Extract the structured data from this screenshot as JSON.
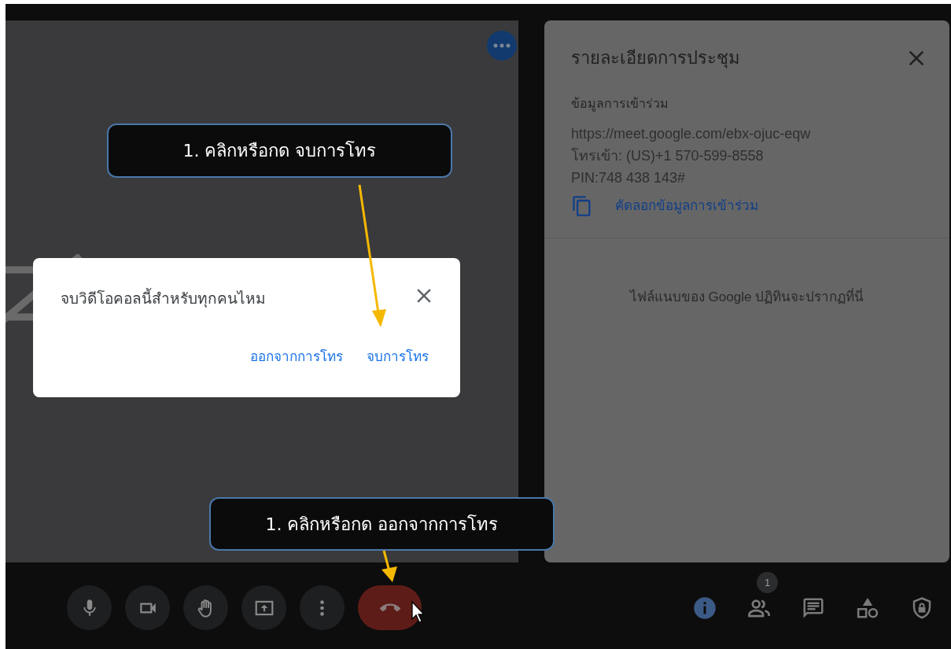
{
  "meeting_details": {
    "title": "รายละเอียดการประชุม",
    "section_heading": "ข้อมูลการเข้าร่วม",
    "join_info": [
      "https://meet.google.com/ebx-ojuc-eqw",
      "โทรเข้า: (US)+1 570-599-8558",
      "PIN:748 438 143#"
    ],
    "copy_link": "คัดลอกข้อมูลการเข้าร่วม",
    "attachments_note": "ไฟล์แนบของ Google ปฏิทินจะปรากฏที่นี่"
  },
  "dialog": {
    "question": "จบวิดีโอคอลนี้สำหรับทุกคนไหม",
    "buttons": [
      "ออกจากการโทร",
      "จบการโทร"
    ]
  },
  "callouts": [
    {
      "text": "1. คลิกหรือกด จบการโทร"
    },
    {
      "text": "1. คลิกหรือกด ออกจากการโทร"
    }
  ],
  "controls": [
    {
      "kind": "mic"
    },
    {
      "kind": "camera"
    },
    {
      "kind": "hand"
    },
    {
      "kind": "present"
    },
    {
      "kind": "more"
    },
    {
      "kind": "end_call"
    }
  ],
  "side_controls": [
    {
      "kind": "info",
      "selected": true
    },
    {
      "kind": "people",
      "selected": false,
      "badge": "1"
    },
    {
      "kind": "chat",
      "selected": false
    },
    {
      "kind": "activities",
      "selected": false
    },
    {
      "kind": "safety",
      "selected": false
    }
  ]
}
